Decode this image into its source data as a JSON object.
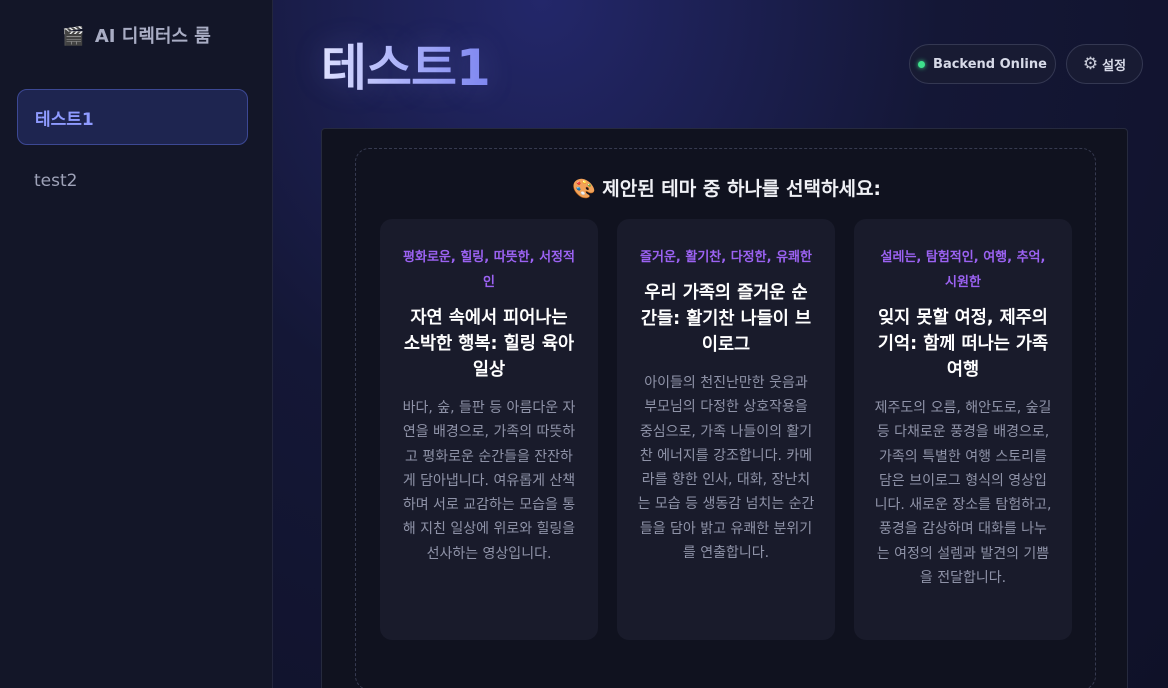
{
  "sidebar": {
    "brand_icon": "🎬",
    "brand": "AI 디렉터스 룸",
    "items": [
      {
        "label": "테스트1",
        "active": true
      },
      {
        "label": "test2",
        "active": false
      }
    ]
  },
  "header": {
    "title": "테스트1",
    "status": {
      "label": "Backend Online",
      "color": "#3ee08c"
    },
    "settings_label": "설정",
    "settings_icon": "⚙"
  },
  "theme_selection": {
    "heading_icon": "🎨",
    "heading": "제안된 테마 중 하나를 선택하세요:",
    "cards": [
      {
        "tags": "평화로운, 힐링, 따뜻한, 서정적인",
        "title": "자연 속에서 피어나는 소박한 행복: 힐링 육아 일상",
        "description": "바다, 숲, 들판 등 아름다운 자연을 배경으로, 가족의 따뜻하고 평화로운 순간들을 잔잔하게 담아냅니다. 여유롭게 산책하며 서로 교감하는 모습을 통해 지친 일상에 위로와 힐링을 선사하는 영상입니다."
      },
      {
        "tags": "즐거운, 활기찬, 다정한, 유쾌한",
        "title": "우리 가족의 즐거운 순간들: 활기찬 나들이 브이로그",
        "description": "아이들의 천진난만한 웃음과 부모님의 다정한 상호작용을 중심으로, 가족 나들이의 활기찬 에너지를 강조합니다. 카메라를 향한 인사, 대화, 장난치는 모습 등 생동감 넘치는 순간들을 담아 밝고 유쾌한 분위기를 연출합니다."
      },
      {
        "tags": "설레는, 탐험적인, 여행, 추억, 시원한",
        "title": "잊지 못할 여정, 제주의 기억: 함께 떠나는 가족 여행",
        "description": "제주도의 오름, 해안도로, 숲길 등 다채로운 풍경을 배경으로, 가족의 특별한 여행 스토리를 담은 브이로그 형식의 영상입니다. 새로운 장소를 탐험하고, 풍경을 감상하며 대화를 나누는 여정의 설렘과 발견의 기쁨을 전달합니다."
      }
    ]
  }
}
